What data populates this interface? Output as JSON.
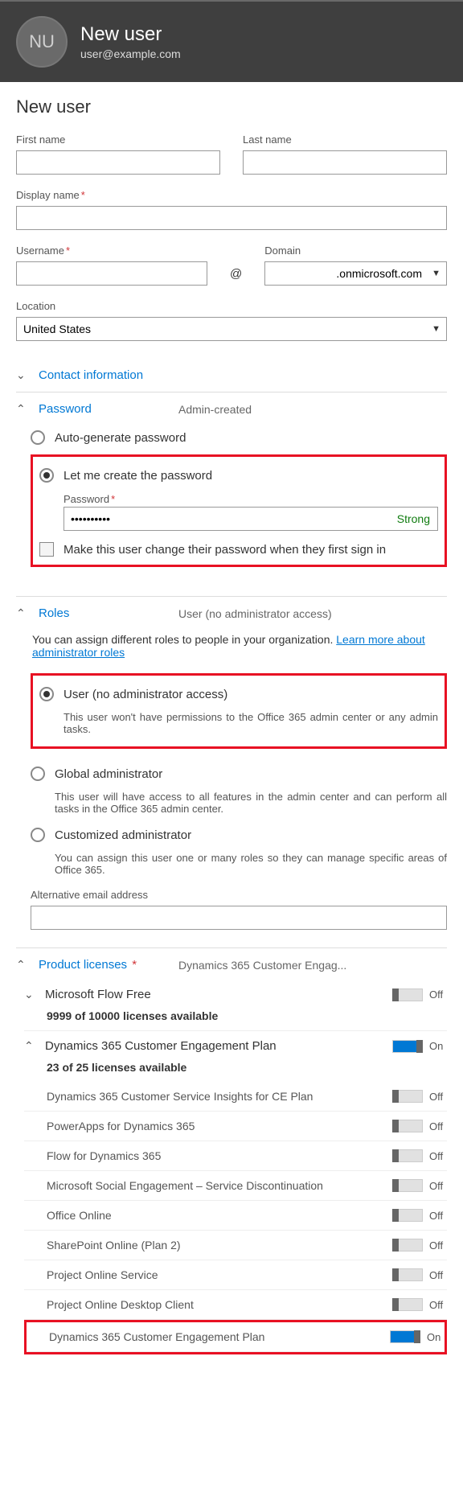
{
  "header": {
    "initials": "NU",
    "title": "New user",
    "email": "user@example.com"
  },
  "page": {
    "title": "New user"
  },
  "fields": {
    "first_name": {
      "label": "First name",
      "value": ""
    },
    "last_name": {
      "label": "Last name",
      "value": ""
    },
    "display_name": {
      "label": "Display name",
      "required": true,
      "value": ""
    },
    "username": {
      "label": "Username",
      "required": true,
      "value": ""
    },
    "domain": {
      "label": "Domain",
      "value": ".onmicrosoft.com"
    },
    "location": {
      "label": "Location",
      "value": "United States"
    },
    "at": "@",
    "alt_email": {
      "label": "Alternative email address",
      "value": ""
    }
  },
  "sections": {
    "contact": {
      "title": "Contact information"
    },
    "password": {
      "title": "Password",
      "summary": "Admin-created",
      "auto": "Auto-generate password",
      "manual": "Let me create the password",
      "pw_label": "Password",
      "pw_value": "••••••••••",
      "strength": "Strong",
      "change_on_signin": "Make this user change their password when they first sign in"
    },
    "roles": {
      "title": "Roles",
      "summary": "User (no administrator access)",
      "intro_a": "You can assign different roles to people in your organization. ",
      "intro_link": "Learn more about administrator roles",
      "options": [
        {
          "label": "User (no administrator access)",
          "desc": "This user won't have permissions to the Office 365 admin center or any admin tasks."
        },
        {
          "label": "Global administrator",
          "desc": "This user will have access to all features in the admin center and can perform all tasks in the Office 365 admin center."
        },
        {
          "label": "Customized administrator",
          "desc": "You can assign this user one or many roles so they can manage specific areas of Office 365."
        }
      ]
    },
    "licenses": {
      "title": "Product licenses",
      "required": true,
      "summary": "Dynamics 365 Customer Engag...",
      "flow": {
        "name": "Microsoft Flow Free",
        "state": "Off",
        "available": "9999 of 10000 licenses available"
      },
      "d365": {
        "name": "Dynamics 365 Customer Engagement Plan",
        "state": "On",
        "available": "23 of 25 licenses available",
        "subs": [
          {
            "name": "Dynamics 365 Customer Service Insights for CE Plan",
            "state": "Off"
          },
          {
            "name": "PowerApps for Dynamics 365",
            "state": "Off"
          },
          {
            "name": "Flow for Dynamics 365",
            "state": "Off"
          },
          {
            "name": "Microsoft Social Engagement – Service Discontinuation",
            "state": "Off"
          },
          {
            "name": "Office Online",
            "state": "Off"
          },
          {
            "name": "SharePoint Online (Plan 2)",
            "state": "Off"
          },
          {
            "name": "Project Online Service",
            "state": "Off"
          },
          {
            "name": "Project Online Desktop Client",
            "state": "Off"
          },
          {
            "name": "Dynamics 365 Customer Engagement Plan",
            "state": "On",
            "highlight": true
          }
        ]
      }
    }
  }
}
